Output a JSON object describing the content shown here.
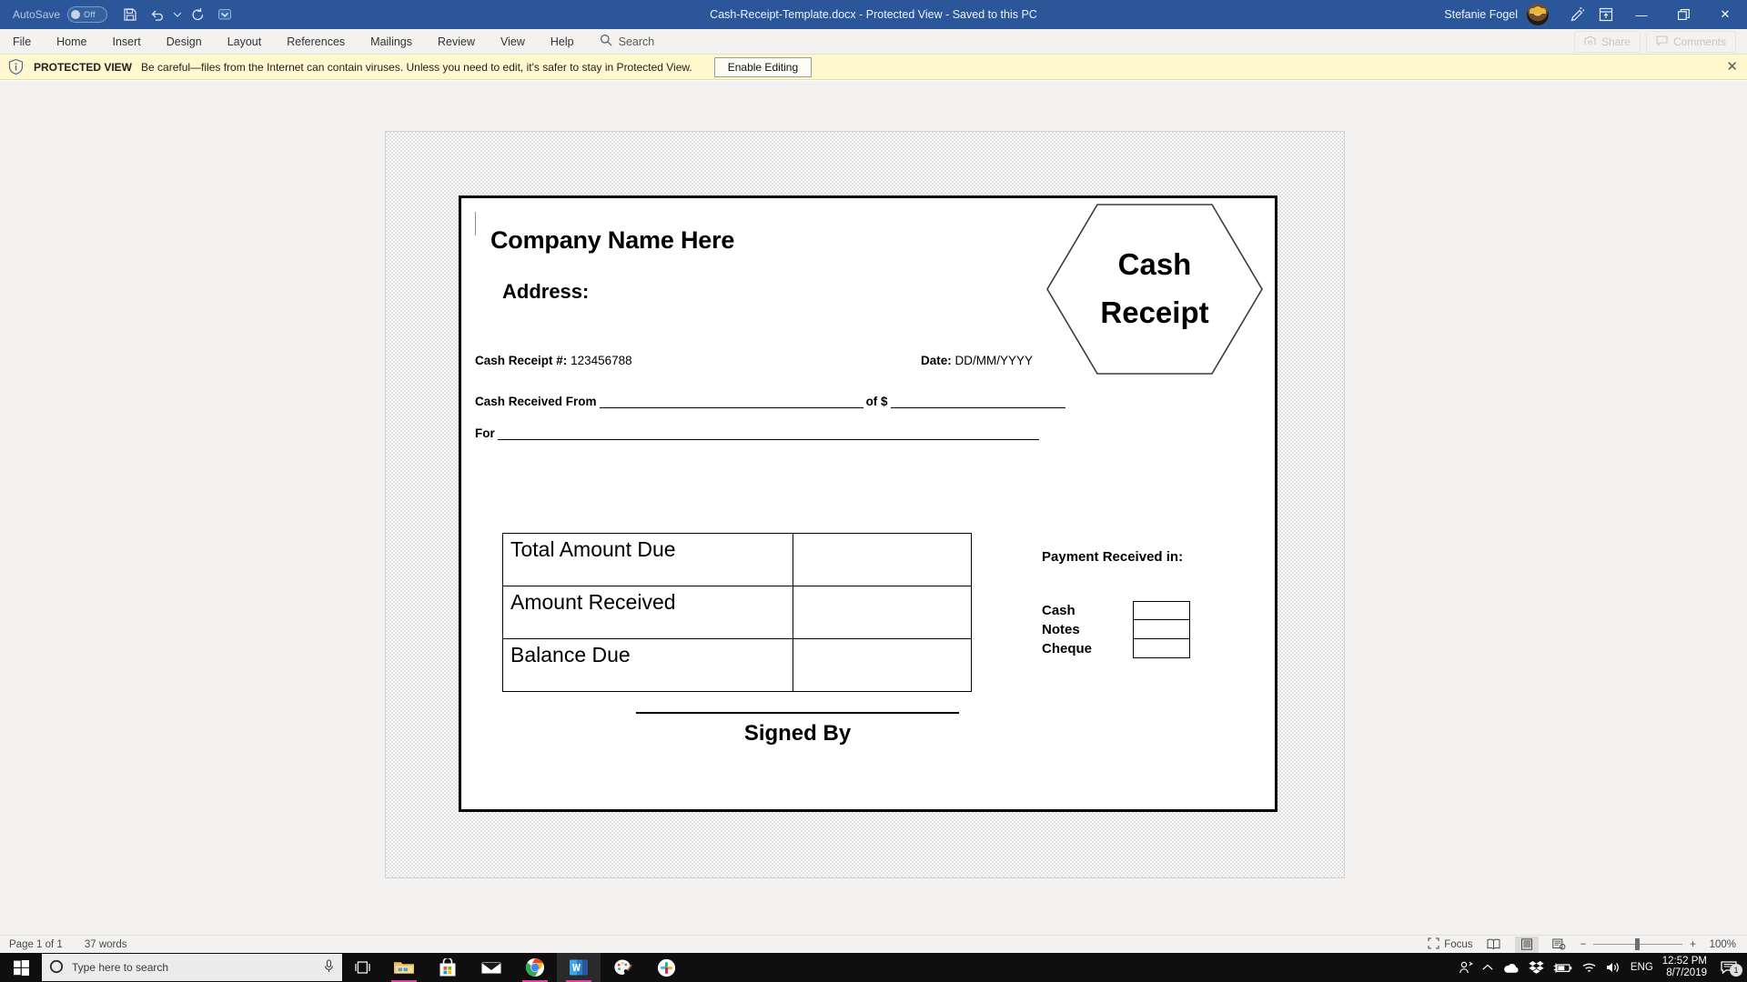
{
  "titlebar": {
    "autosave_label": "AutoSave",
    "autosave_state": "Off",
    "document_title": "Cash-Receipt-Template.docx  -  Protected View  -  Saved to this PC",
    "user_name": "Stefanie Fogel",
    "icons": {
      "save": "save-icon",
      "undo": "undo-icon",
      "redo": "redo-icon",
      "customize": "customize-quick-access-icon",
      "pen": "pen-icon",
      "ribbon_options": "ribbon-display-options-icon"
    },
    "window_buttons": {
      "minimize": "—",
      "restore": "❐",
      "close": "✕"
    }
  },
  "ribbon": {
    "tabs": [
      {
        "label": "File"
      },
      {
        "label": "Home"
      },
      {
        "label": "Insert"
      },
      {
        "label": "Design"
      },
      {
        "label": "Layout"
      },
      {
        "label": "References"
      },
      {
        "label": "Mailings"
      },
      {
        "label": "Review"
      },
      {
        "label": "View"
      },
      {
        "label": "Help"
      }
    ],
    "search_label": "Search",
    "share_label": "Share",
    "comments_label": "Comments"
  },
  "protected_view": {
    "title": "PROTECTED VIEW",
    "message": "Be careful—files from the Internet can contain viruses. Unless you need to edit, it's safer to stay in Protected View.",
    "enable_button": "Enable Editing",
    "close": "✕"
  },
  "document": {
    "company_name": "Company Name Here",
    "address_label": "Address:",
    "logo": {
      "line1": "Cash",
      "line2": "Receipt"
    },
    "receipt_number": {
      "label": "Cash Receipt #:",
      "value": "123456788"
    },
    "date": {
      "label": "Date:",
      "value": "DD/MM/YYYY"
    },
    "cash_received_from": {
      "label": "Cash Received From",
      "of_label": "of $"
    },
    "for_label": "For",
    "amount_table": {
      "rows": [
        {
          "label": "Total Amount Due",
          "value": ""
        },
        {
          "label": "Amount Received",
          "value": ""
        },
        {
          "label": "Balance Due",
          "value": ""
        }
      ]
    },
    "payment": {
      "title": "Payment Received in:",
      "methods": [
        {
          "label": "Cash",
          "value": ""
        },
        {
          "label": "Notes",
          "value": ""
        },
        {
          "label": "Cheque",
          "value": ""
        }
      ]
    },
    "signed_by": "Signed By"
  },
  "statusbar": {
    "page_info": "Page 1 of 1",
    "word_count": "37 words",
    "focus_label": "Focus",
    "views": [
      "read-mode-icon",
      "print-layout-icon",
      "web-layout-icon"
    ],
    "zoom_minus": "−",
    "zoom_plus": "+",
    "zoom_level": "100%"
  },
  "taskbar": {
    "search_placeholder": "Type here to search",
    "apps": [
      {
        "name": "file-explorer"
      },
      {
        "name": "microsoft-store"
      },
      {
        "name": "mail"
      },
      {
        "name": "google-chrome"
      },
      {
        "name": "microsoft-word"
      },
      {
        "name": "paint-3d"
      },
      {
        "name": "slack"
      }
    ],
    "tray": {
      "language": "ENG",
      "time": "12:52 PM",
      "date": "8/7/2019",
      "notification_count": "1"
    }
  },
  "colors": {
    "word_blue": "#2b579a",
    "protected_yellow": "#fff7cd",
    "ribbon_gray": "#f3f2f1",
    "taskbar_black": "#0f0f0f"
  }
}
